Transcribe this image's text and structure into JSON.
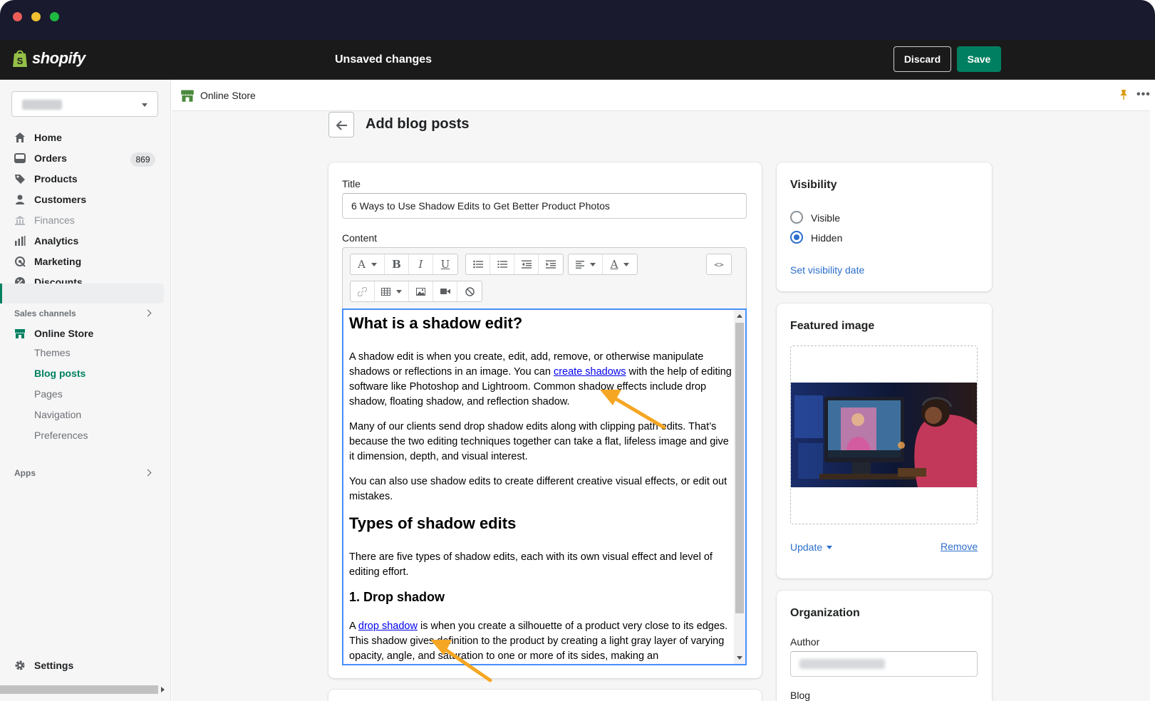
{
  "window": {
    "controls": [
      "close",
      "minimize",
      "maximize"
    ]
  },
  "topbar": {
    "logo_text": "shopify",
    "status": "Unsaved changes",
    "discard_label": "Discard",
    "save_label": "Save"
  },
  "sidebar": {
    "store_name": "",
    "items": [
      {
        "label": "Home",
        "icon": "home-icon"
      },
      {
        "label": "Orders",
        "icon": "orders-icon",
        "badge": "869"
      },
      {
        "label": "Products",
        "icon": "tag-icon"
      },
      {
        "label": "Customers",
        "icon": "person-icon"
      },
      {
        "label": "Finances",
        "icon": "bank-icon",
        "disabled": true
      },
      {
        "label": "Analytics",
        "icon": "bar-chart-icon"
      },
      {
        "label": "Marketing",
        "icon": "target-icon"
      },
      {
        "label": "Discounts",
        "icon": "discount-icon"
      }
    ],
    "sales_channels_label": "Sales channels",
    "online_store_label": "Online Store",
    "sub_items": [
      "Themes",
      "Blog posts",
      "Pages",
      "Navigation",
      "Preferences"
    ],
    "active_sub_item": "Blog posts",
    "apps_label": "Apps",
    "settings_label": "Settings"
  },
  "breadcrumb": {
    "label": "Online Store"
  },
  "page": {
    "title": "Add blog posts"
  },
  "form": {
    "title_label": "Title",
    "title_value": "6 Ways to Use Shadow Edits to Get Better Product Photos",
    "content_label": "Content"
  },
  "editor": {
    "h2_1": "What is a shadow edit?",
    "p1_a": "A shadow edit is when you create, edit, add, remove, or otherwise manipulate shadows or reflections in an image. You can ",
    "p1_link": "create shadows",
    "p1_b": " with the help of editing software like Photoshop and Lightroom. Common shadow effects include drop shadow, floating shadow, and reflection shadow.",
    "p2": "Many of our clients send drop shadow edits along with clipping path edits. That’s because the two editing techniques together can take a flat, lifeless image and give it dimension, depth, and visual interest.",
    "p3": "You can also use shadow edits to create different creative visual effects, or edit out mistakes.",
    "h2_2": "Types of shadow edits",
    "p4": "There are five types of shadow edits, each with its own visual effect and level of editing effort.",
    "h3_1": "1. Drop shadow",
    "p5_a": "A ",
    "p5_link": "drop shadow",
    "p5_b": " is when you create a silhouette of a product very close to its edges. This shadow gives definition to the product by creating a light gray layer of varying opacity, angle, and saturation to one or more of its sides, making an"
  },
  "toolbar": {
    "font_label": "A",
    "bold_label": "B",
    "italic_label": "I",
    "underline_label": "U",
    "color_label": "A",
    "html_label": "<>"
  },
  "visibility": {
    "title": "Visibility",
    "options": [
      "Visible",
      "Hidden"
    ],
    "selected": "Hidden",
    "set_date_label": "Set visibility date"
  },
  "featured_image": {
    "title": "Featured image",
    "update_label": "Update",
    "remove_label": "Remove"
  },
  "organization": {
    "title": "Organization",
    "author_label": "Author",
    "author_value": "",
    "blog_label": "Blog"
  },
  "colors": {
    "accent": "#008060",
    "link": "#2c6ecb",
    "topbar": "#1a1a1a",
    "arrow_annotation": "#f5a623"
  }
}
